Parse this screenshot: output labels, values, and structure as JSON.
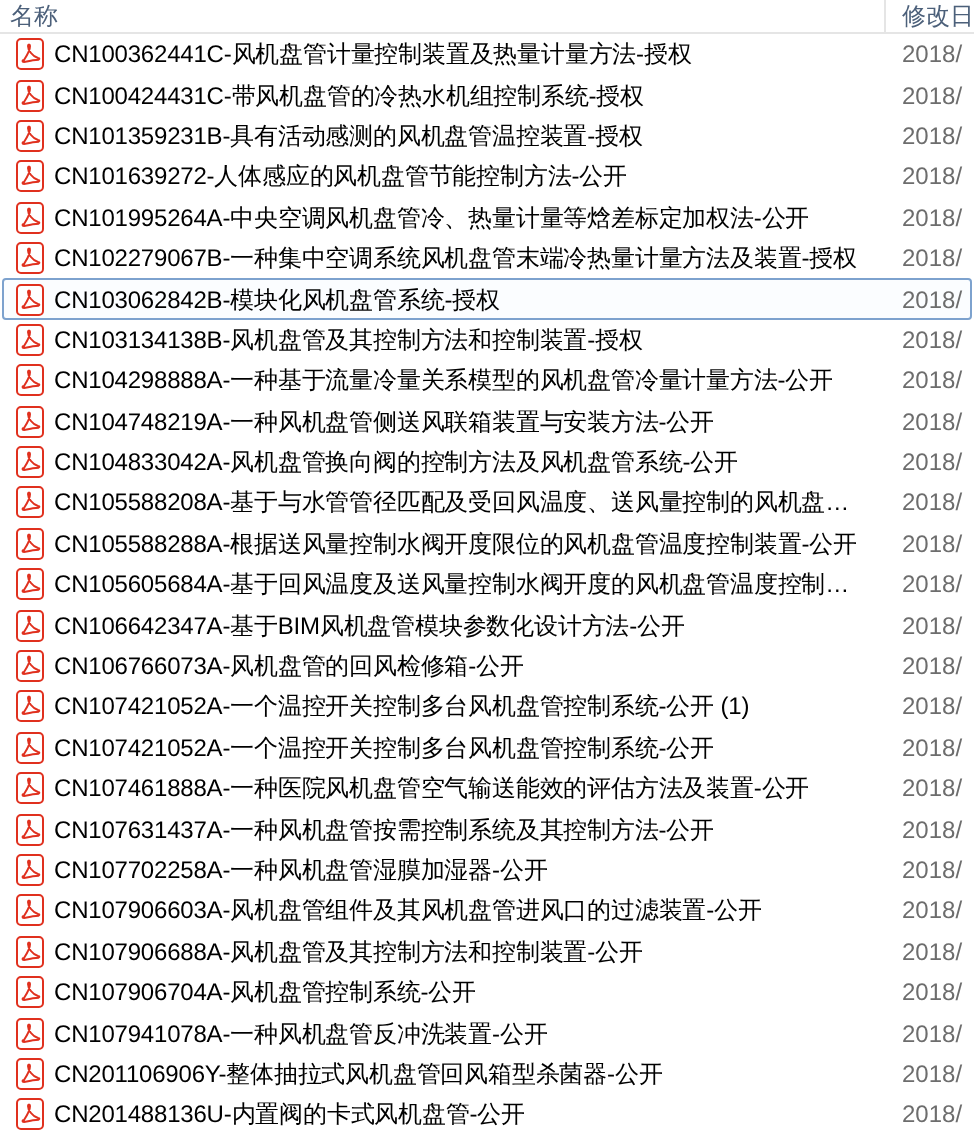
{
  "columns": [
    {
      "label": "名称"
    },
    {
      "label": "修改日"
    }
  ],
  "files": [
    {
      "name": "CN100362441C-风机盘管计量控制装置及热量计量方法-授权",
      "date": "2018/",
      "selected": false
    },
    {
      "name": "CN100424431C-带风机盘管的冷热水机组控制系统-授权",
      "date": "2018/",
      "selected": false
    },
    {
      "name": "CN101359231B-具有活动感测的风机盘管温控装置-授权",
      "date": "2018/",
      "selected": false
    },
    {
      "name": "CN101639272-人体感应的风机盘管节能控制方法-公开",
      "date": "2018/",
      "selected": false
    },
    {
      "name": "CN101995264A-中央空调风机盘管冷、热量计量等焓差标定加权法-公开",
      "date": "2018/",
      "selected": false
    },
    {
      "name": "CN102279067B-一种集中空调系统风机盘管末端冷热量计量方法及装置-授权",
      "date": "2018/",
      "selected": false
    },
    {
      "name": "CN103062842B-模块化风机盘管系统-授权",
      "date": "2018/",
      "selected": true
    },
    {
      "name": "CN103134138B-风机盘管及其控制方法和控制装置-授权",
      "date": "2018/",
      "selected": false
    },
    {
      "name": "CN104298888A-一种基于流量冷量关系模型的风机盘管冷量计量方法-公开",
      "date": "2018/",
      "selected": false
    },
    {
      "name": "CN104748219A-一种风机盘管侧送风联箱装置与安装方法-公开",
      "date": "2018/",
      "selected": false
    },
    {
      "name": "CN104833042A-风机盘管换向阀的控制方法及风机盘管系统-公开",
      "date": "2018/",
      "selected": false
    },
    {
      "name": "CN105588208A-基于与水管管径匹配及受回风温度、送风量控制的风机盘…",
      "date": "2018/",
      "selected": false
    },
    {
      "name": "CN105588288A-根据送风量控制水阀开度限位的风机盘管温度控制装置-公开",
      "date": "2018/",
      "selected": false
    },
    {
      "name": "CN105605684A-基于回风温度及送风量控制水阀开度的风机盘管温度控制…",
      "date": "2018/",
      "selected": false
    },
    {
      "name": "CN106642347A-基于BIM风机盘管模块参数化设计方法-公开",
      "date": "2018/",
      "selected": false
    },
    {
      "name": "CN106766073A-风机盘管的回风检修箱-公开",
      "date": "2018/",
      "selected": false
    },
    {
      "name": "CN107421052A-一个温控开关控制多台风机盘管控制系统-公开 (1)",
      "date": "2018/",
      "selected": false
    },
    {
      "name": "CN107421052A-一个温控开关控制多台风机盘管控制系统-公开",
      "date": "2018/",
      "selected": false
    },
    {
      "name": "CN107461888A-一种医院风机盘管空气输送能效的评估方法及装置-公开",
      "date": "2018/",
      "selected": false
    },
    {
      "name": "CN107631437A-一种风机盘管按需控制系统及其控制方法-公开",
      "date": "2018/",
      "selected": false
    },
    {
      "name": "CN107702258A-一种风机盘管湿膜加湿器-公开",
      "date": "2018/",
      "selected": false
    },
    {
      "name": "CN107906603A-风机盘管组件及其风机盘管进风口的过滤装置-公开",
      "date": "2018/",
      "selected": false
    },
    {
      "name": "CN107906688A-风机盘管及其控制方法和控制装置-公开",
      "date": "2018/",
      "selected": false
    },
    {
      "name": "CN107906704A-风机盘管控制系统-公开",
      "date": "2018/",
      "selected": false
    },
    {
      "name": "CN107941078A-一种风机盘管反冲洗装置-公开",
      "date": "2018/",
      "selected": false
    },
    {
      "name": "CN201106906Y-整体抽拉式风机盘管回风箱型杀菌器-公开",
      "date": "2018/",
      "selected": false
    },
    {
      "name": "CN201488136U-内置阀的卡式风机盘管-公开",
      "date": "2018/",
      "selected": false
    }
  ]
}
